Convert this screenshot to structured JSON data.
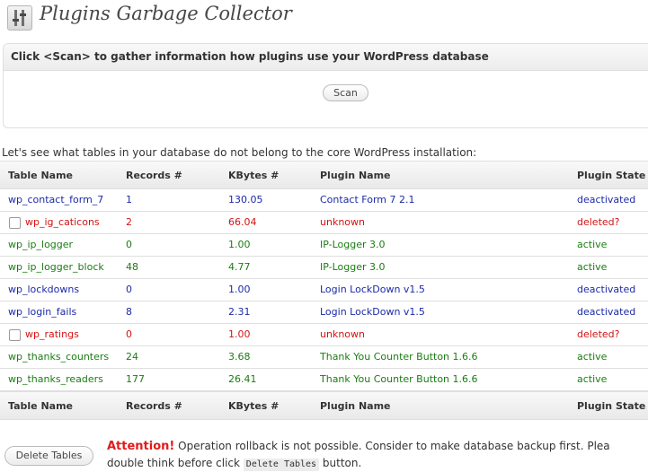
{
  "header": {
    "title": "Plugins Garbage Collector",
    "icon": "plugin-settings-icon"
  },
  "scan_box": {
    "instruction": "Click <Scan> to gather information how plugins use your WordPress database",
    "scan_label": "Scan"
  },
  "intro": "Let's see what tables in your database do not belong to the core WordPress installation:",
  "colors": {
    "blue": "#1c2aa8",
    "green": "#1a7d12",
    "red": "#d31414",
    "attention": "#e11b1b"
  },
  "table": {
    "columns": [
      "Table Name",
      "Records #",
      "KBytes #",
      "Plugin Name",
      "Plugin State"
    ],
    "rows": [
      {
        "name": "wp_contact_form_7",
        "records": "1",
        "kbytes": "130.05",
        "plugin": "Contact Form 7 2.1",
        "state": "deactivated",
        "color": "blue",
        "checkbox": false
      },
      {
        "name": "wp_ig_caticons",
        "records": "2",
        "kbytes": "66.04",
        "plugin": "unknown",
        "state": "deleted?",
        "color": "red",
        "checkbox": true
      },
      {
        "name": "wp_ip_logger",
        "records": "0",
        "kbytes": "1.00",
        "plugin": "IP-Logger 3.0",
        "state": "active",
        "color": "green",
        "checkbox": false
      },
      {
        "name": "wp_ip_logger_block",
        "records": "48",
        "kbytes": "4.77",
        "plugin": "IP-Logger 3.0",
        "state": "active",
        "color": "green",
        "checkbox": false
      },
      {
        "name": "wp_lockdowns",
        "records": "0",
        "kbytes": "1.00",
        "plugin": "Login LockDown v1.5",
        "state": "deactivated",
        "color": "blue",
        "checkbox": false
      },
      {
        "name": "wp_login_fails",
        "records": "8",
        "kbytes": "2.31",
        "plugin": "Login LockDown v1.5",
        "state": "deactivated",
        "color": "blue",
        "checkbox": false
      },
      {
        "name": "wp_ratings",
        "records": "0",
        "kbytes": "1.00",
        "plugin": "unknown",
        "state": "deleted?",
        "color": "red",
        "checkbox": true
      },
      {
        "name": "wp_thanks_counters",
        "records": "24",
        "kbytes": "3.68",
        "plugin": "Thank You Counter Button 1.6.6",
        "state": "active",
        "color": "green",
        "checkbox": false
      },
      {
        "name": "wp_thanks_readers",
        "records": "177",
        "kbytes": "26.41",
        "plugin": "Thank You Counter Button 1.6.6",
        "state": "active",
        "color": "green",
        "checkbox": false
      }
    ]
  },
  "footer": {
    "delete_label": "Delete Tables",
    "attention": "Attention!",
    "warning_line1": " Operation rollback is not possible. Consider to make database backup first. Plea",
    "warning_line2_start": "double think before click ",
    "code_chip": "Delete Tables",
    "warning_line2_end": " button."
  }
}
